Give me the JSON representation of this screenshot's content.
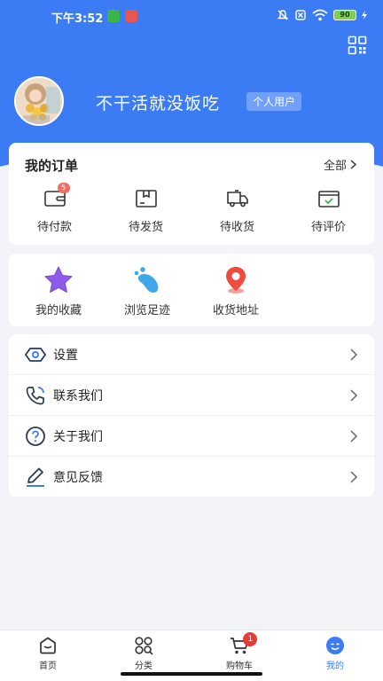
{
  "status_bar": {
    "time": "下午3:52",
    "battery": "90"
  },
  "user": {
    "name": "不干活就没饭吃",
    "type": "个人用户"
  },
  "orders": {
    "title": "我的订单",
    "all_label": "全部",
    "items": [
      {
        "label": "待付款",
        "icon": "wallet-icon",
        "badge": "5"
      },
      {
        "label": "待发货",
        "icon": "package-icon"
      },
      {
        "label": "待收货",
        "icon": "truck-icon"
      },
      {
        "label": "待评价",
        "icon": "review-icon"
      }
    ]
  },
  "shortcuts": [
    {
      "label": "我的收藏",
      "icon": "star-icon"
    },
    {
      "label": "浏览足迹",
      "icon": "footprint-icon"
    },
    {
      "label": "收货地址",
      "icon": "location-pin-icon"
    }
  ],
  "menu": [
    {
      "label": "设置",
      "icon": "settings-icon"
    },
    {
      "label": "联系我们",
      "icon": "phone-icon"
    },
    {
      "label": "关于我们",
      "icon": "help-icon"
    },
    {
      "label": "意见反馈",
      "icon": "edit-icon"
    }
  ],
  "tabbar": {
    "items": [
      {
        "label": "首页",
        "icon": "home-icon"
      },
      {
        "label": "分类",
        "icon": "category-icon"
      },
      {
        "label": "购物车",
        "icon": "cart-icon",
        "badge": "1"
      },
      {
        "label": "我的",
        "icon": "profile-icon",
        "active": true
      }
    ]
  },
  "colors": {
    "primary": "#3b7cf5",
    "badge": "#e53b34",
    "background": "#f3f4f8"
  }
}
